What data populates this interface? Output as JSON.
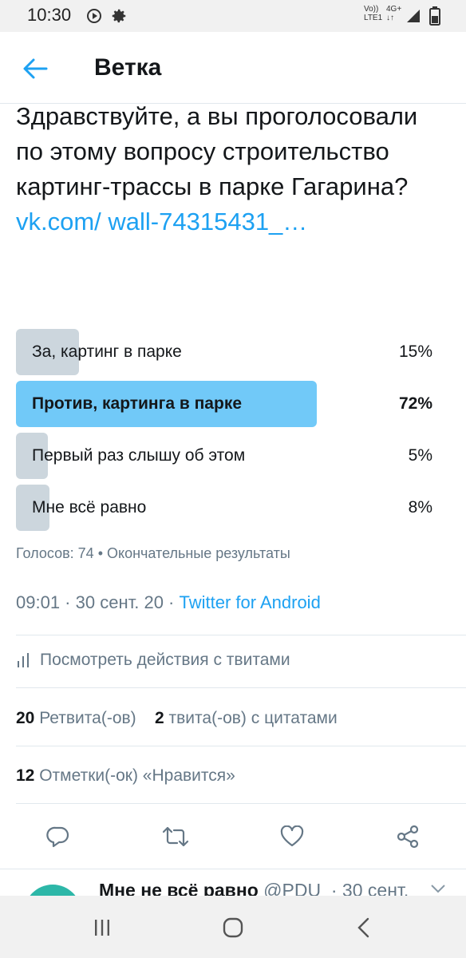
{
  "status_bar": {
    "time": "10:30",
    "carrier_line1": "Vo))",
    "carrier_line2": "LTE1",
    "network": "4G+"
  },
  "header": {
    "title": "Ветка"
  },
  "tweet": {
    "text": "Здравствуйте, а вы проголосовали по этому вопросу строительство картинг-трассы в парке Гагарина? ",
    "link": "vk.com/ wall-74315431_…"
  },
  "poll": {
    "options": [
      {
        "label": "За, картинг в парке",
        "percent_text": "15%",
        "percent": 15,
        "winner": false
      },
      {
        "label": "Против, картинга в парке",
        "percent_text": "72%",
        "percent": 72,
        "winner": true
      },
      {
        "label": "Первый раз слышу об этом",
        "percent_text": "5%",
        "percent": 5,
        "winner": false
      },
      {
        "label": "Мне всё равно",
        "percent_text": "8%",
        "percent": 8,
        "winner": false
      }
    ],
    "votes": "Голосов: 74",
    "status": "Окончательные результаты"
  },
  "meta": {
    "time": "09:01",
    "date": "30 сент. 20",
    "source": "Twitter for Android"
  },
  "activity": {
    "label": "Посмотреть действия с твитами"
  },
  "stats": {
    "retweets_count": "20",
    "retweets_label": "Ретвита(-ов)",
    "quotes_count": "2",
    "quotes_label": "твита(-ов) с цитатами",
    "likes_count": "12",
    "likes_label": "Отметки(-ок) «Нравится»"
  },
  "reply": {
    "name": "Мне не всё равно",
    "handle": "@PDU",
    "date": "· 30 сент."
  },
  "colors": {
    "accent": "#1da1f2",
    "winner_fill": "#71c9f8",
    "bar_fill": "#ccd6dd",
    "muted_text": "#657786"
  }
}
